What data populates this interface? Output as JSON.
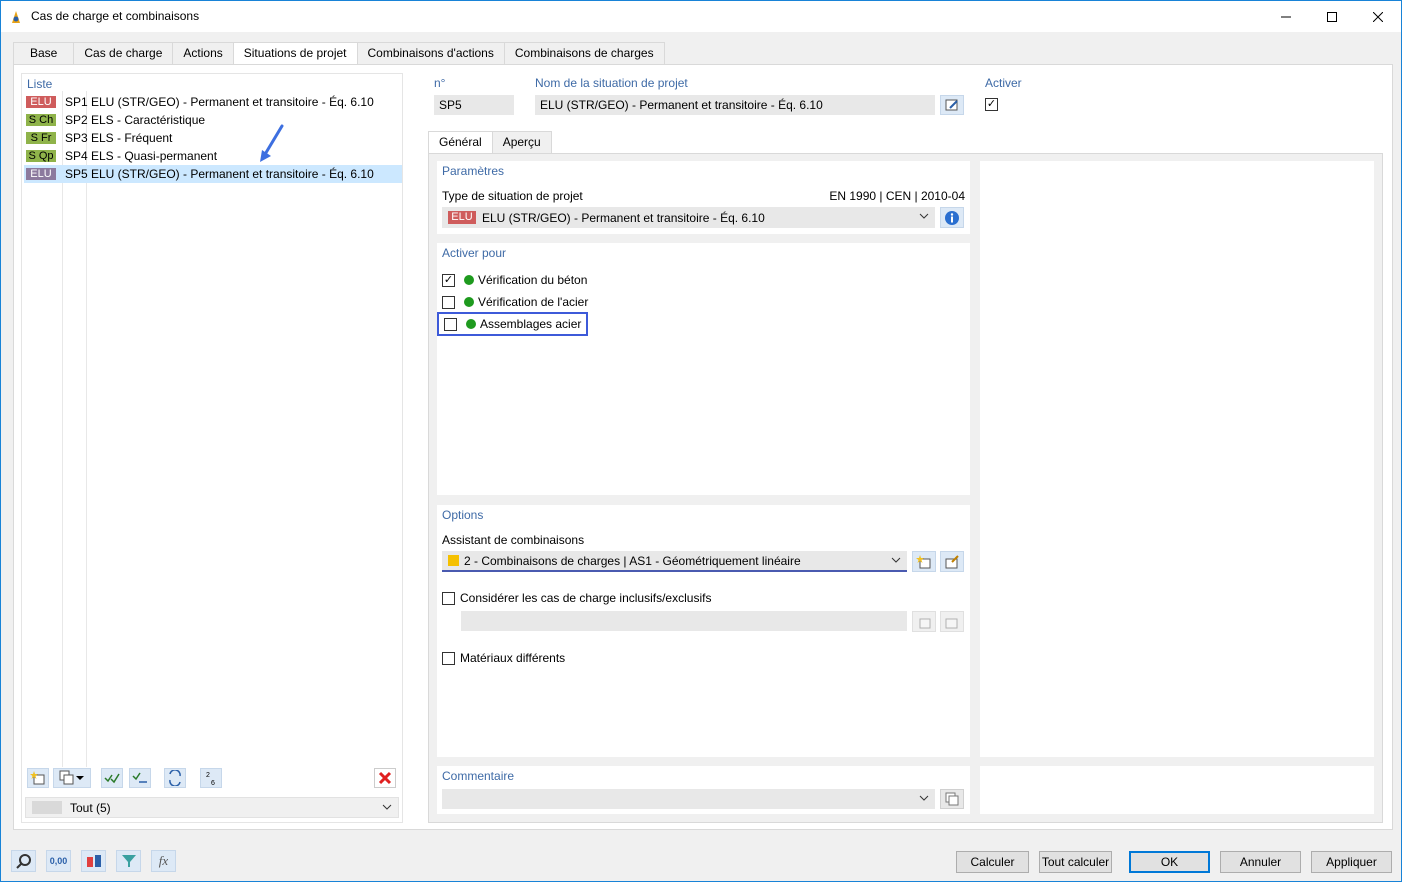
{
  "window": {
    "title": "Cas de charge et combinaisons"
  },
  "tabs": [
    "Base",
    "Cas de charge",
    "Actions",
    "Situations de projet",
    "Combinaisons d'actions",
    "Combinaisons de charges"
  ],
  "list": {
    "header": "Liste",
    "items": [
      {
        "badge": "ELU",
        "badge_color": "#cf5c5c",
        "id": "SP1",
        "name": "ELU (STR/GEO) - Permanent et transitoire - Éq. 6.10"
      },
      {
        "badge": "S Ch",
        "badge_color": "#8fb34a",
        "id": "SP2",
        "name": "ELS - Caractéristique"
      },
      {
        "badge": "S Fr",
        "badge_color": "#8fb34a",
        "id": "SP3",
        "name": "ELS - Fréquent"
      },
      {
        "badge": "S Qp",
        "badge_color": "#8fb34a",
        "id": "SP4",
        "name": "ELS - Quasi-permanent"
      },
      {
        "badge": "ELU",
        "badge_color": "#8c7a9e",
        "id": "SP5",
        "name": "ELU (STR/GEO) - Permanent et transitoire - Éq. 6.10"
      }
    ],
    "filter": "Tout (5)"
  },
  "header_fields": {
    "num_label": "n°",
    "num_value": "SP5",
    "name_label": "Nom de la situation de projet",
    "name_value": "ELU (STR/GEO) - Permanent et transitoire - Éq. 6.10",
    "activate_label": "Activer"
  },
  "subtabs": [
    "Général",
    "Aperçu"
  ],
  "parametres": {
    "title": "Paramètres",
    "type_label": "Type de situation de projet",
    "norm": "EN 1990 | CEN | 2010-04",
    "type_badge": "ELU",
    "type_value": "ELU (STR/GEO) - Permanent et transitoire - Éq. 6.10"
  },
  "activer_pour": {
    "title": "Activer pour",
    "items": [
      {
        "label": "Vérification du béton",
        "checked": true
      },
      {
        "label": "Vérification de l'acier",
        "checked": false
      },
      {
        "label": "Assemblages acier",
        "checked": false
      }
    ]
  },
  "options": {
    "title": "Options",
    "assistant_label": "Assistant de combinaisons",
    "assistant_value": "2 - Combinaisons de charges | AS1 - Géométriquement linéaire",
    "inclusive_label": "Considérer les cas de charge inclusifs/exclusifs",
    "materials_label": "Matériaux différents"
  },
  "commentaire": {
    "title": "Commentaire"
  },
  "buttons": {
    "calculer": "Calculer",
    "tout_calculer": "Tout calculer",
    "ok": "OK",
    "annuler": "Annuler",
    "appliquer": "Appliquer"
  },
  "bottom_icons": [
    "search-icon",
    "numeric-units-icon",
    "model-display-icon",
    "filter-icon",
    "function-icon"
  ],
  "bottom_icon_labels": {
    "numeric": "0,00",
    "function": "fx"
  }
}
